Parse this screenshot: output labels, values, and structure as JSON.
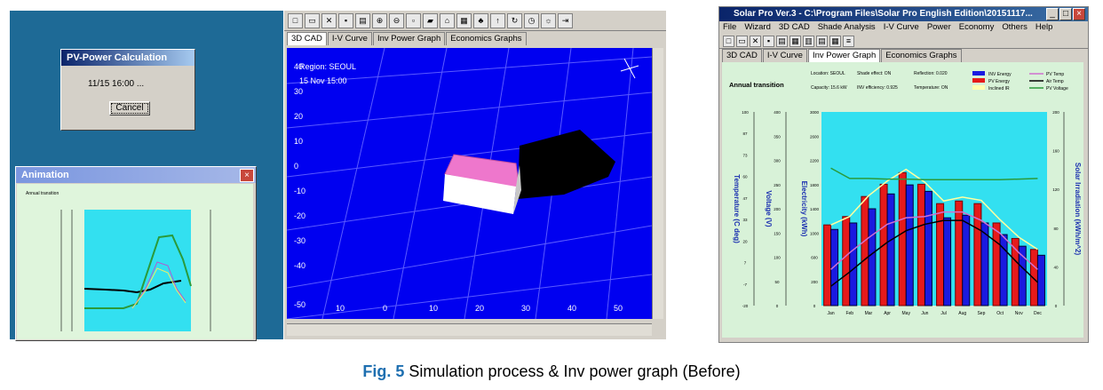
{
  "pvcalc": {
    "title": "PV-Power Calculation",
    "status": "11/15 16:00 ...",
    "cancel": "Cancel"
  },
  "anim": {
    "title": "Animation",
    "transition": "Annual transition",
    "close": "×"
  },
  "mid": {
    "tabs": [
      "3D CAD",
      "I-V Curve",
      "Inv Power Graph",
      "Economics Graphs"
    ],
    "region": "Region: SEOUL",
    "date": "15 Nov 15:00",
    "yticks": [
      "40",
      "30",
      "20",
      "10",
      "0",
      "-10",
      "-20",
      "-30",
      "-40",
      "-50"
    ],
    "xticks": [
      "10",
      "0",
      "10",
      "20",
      "30",
      "40",
      "50"
    ],
    "colors": {
      "sky": "#0000f0",
      "grid": "#4a4aff",
      "roof": "#ee77cc",
      "wall": "#ffffff",
      "shadow": "#000000"
    }
  },
  "rwin": {
    "title": "Solar Pro Ver.3 - C:\\Program Files\\Solar Pro English Edition\\20151117...",
    "menu": [
      "File",
      "Wizard",
      "3D CAD",
      "Shade Analysis",
      "I-V Curve",
      "Power",
      "Economy",
      "Others",
      "Help"
    ],
    "tabs": [
      "3D CAD",
      "I-V Curve",
      "Inv Power Graph",
      "Economics Graphs"
    ],
    "info": {
      "transition": "Annual transition",
      "location": "Location: SEOUL",
      "capacity": "Capacity: 15.6 kW",
      "shade": "Shade effect: ON",
      "inv_eff": "INV efficiency: 0.925",
      "reflection": "Reflection: 0.020",
      "temp": "Temperature: ON"
    },
    "legend": [
      "INV Energy",
      "PV Energy",
      "Inclined IR",
      "PV Temp",
      "Air Temp",
      "PV Voltage"
    ],
    "axis_labels": {
      "temp": "Temperature (C deg)",
      "volt": "Voltage (V)",
      "elec": "Electricity (kWh)",
      "irr": "Solar Irradiation (kWh/m^2)"
    },
    "temp_ticks": [
      "100",
      "87",
      "73",
      "60",
      "47",
      "33",
      "20",
      "7",
      "-7",
      "-20"
    ],
    "volt_ticks": [
      "400",
      "350",
      "300",
      "250",
      "200",
      "150",
      "100",
      "50",
      "0"
    ],
    "elec_ticks": [
      "3000",
      "2600",
      "2200",
      "1800",
      "1400",
      "1000",
      "600",
      "200",
      "0"
    ],
    "irr_ticks": [
      "200",
      "160",
      "120",
      "80",
      "40",
      "0"
    ]
  },
  "chart_data": {
    "type": "bar",
    "categories": [
      "Jan",
      "Feb",
      "Mar",
      "Apr",
      "May",
      "Jun",
      "Jul",
      "Aug",
      "Sep",
      "Oct",
      "Nov",
      "Dec"
    ],
    "series": [
      {
        "name": "INV Energy",
        "values": [
          1180,
          1280,
          1500,
          1730,
          1870,
          1770,
          1360,
          1400,
          1280,
          1100,
          920,
          780
        ]
      },
      {
        "name": "PV Energy",
        "values": [
          1250,
          1380,
          1690,
          1880,
          2060,
          1880,
          1580,
          1620,
          1580,
          1280,
          1040,
          870
        ]
      },
      {
        "name": "Inclined IR",
        "values": [
          1250,
          1380,
          1700,
          1930,
          2110,
          1910,
          1620,
          1680,
          1630,
          1330,
          1060,
          870
        ]
      },
      {
        "name": "PV Temp",
        "values": [
          560,
          820,
          1050,
          1260,
          1360,
          1380,
          1450,
          1450,
          1320,
          1120,
          820,
          560
        ]
      },
      {
        "name": "Air Temp",
        "values": [
          300,
          520,
          760,
          980,
          1160,
          1260,
          1320,
          1320,
          1160,
          940,
          640,
          360
        ]
      },
      {
        "name": "PV Voltage",
        "values": [
          2130,
          1970,
          1970,
          1960,
          1960,
          1950,
          1950,
          1950,
          1950,
          1950,
          1960,
          1970
        ]
      }
    ],
    "ylim": [
      0,
      3000
    ]
  },
  "caption": {
    "fig": "Fig. 5",
    "text": " Simulation process & Inv power graph (Before)"
  }
}
